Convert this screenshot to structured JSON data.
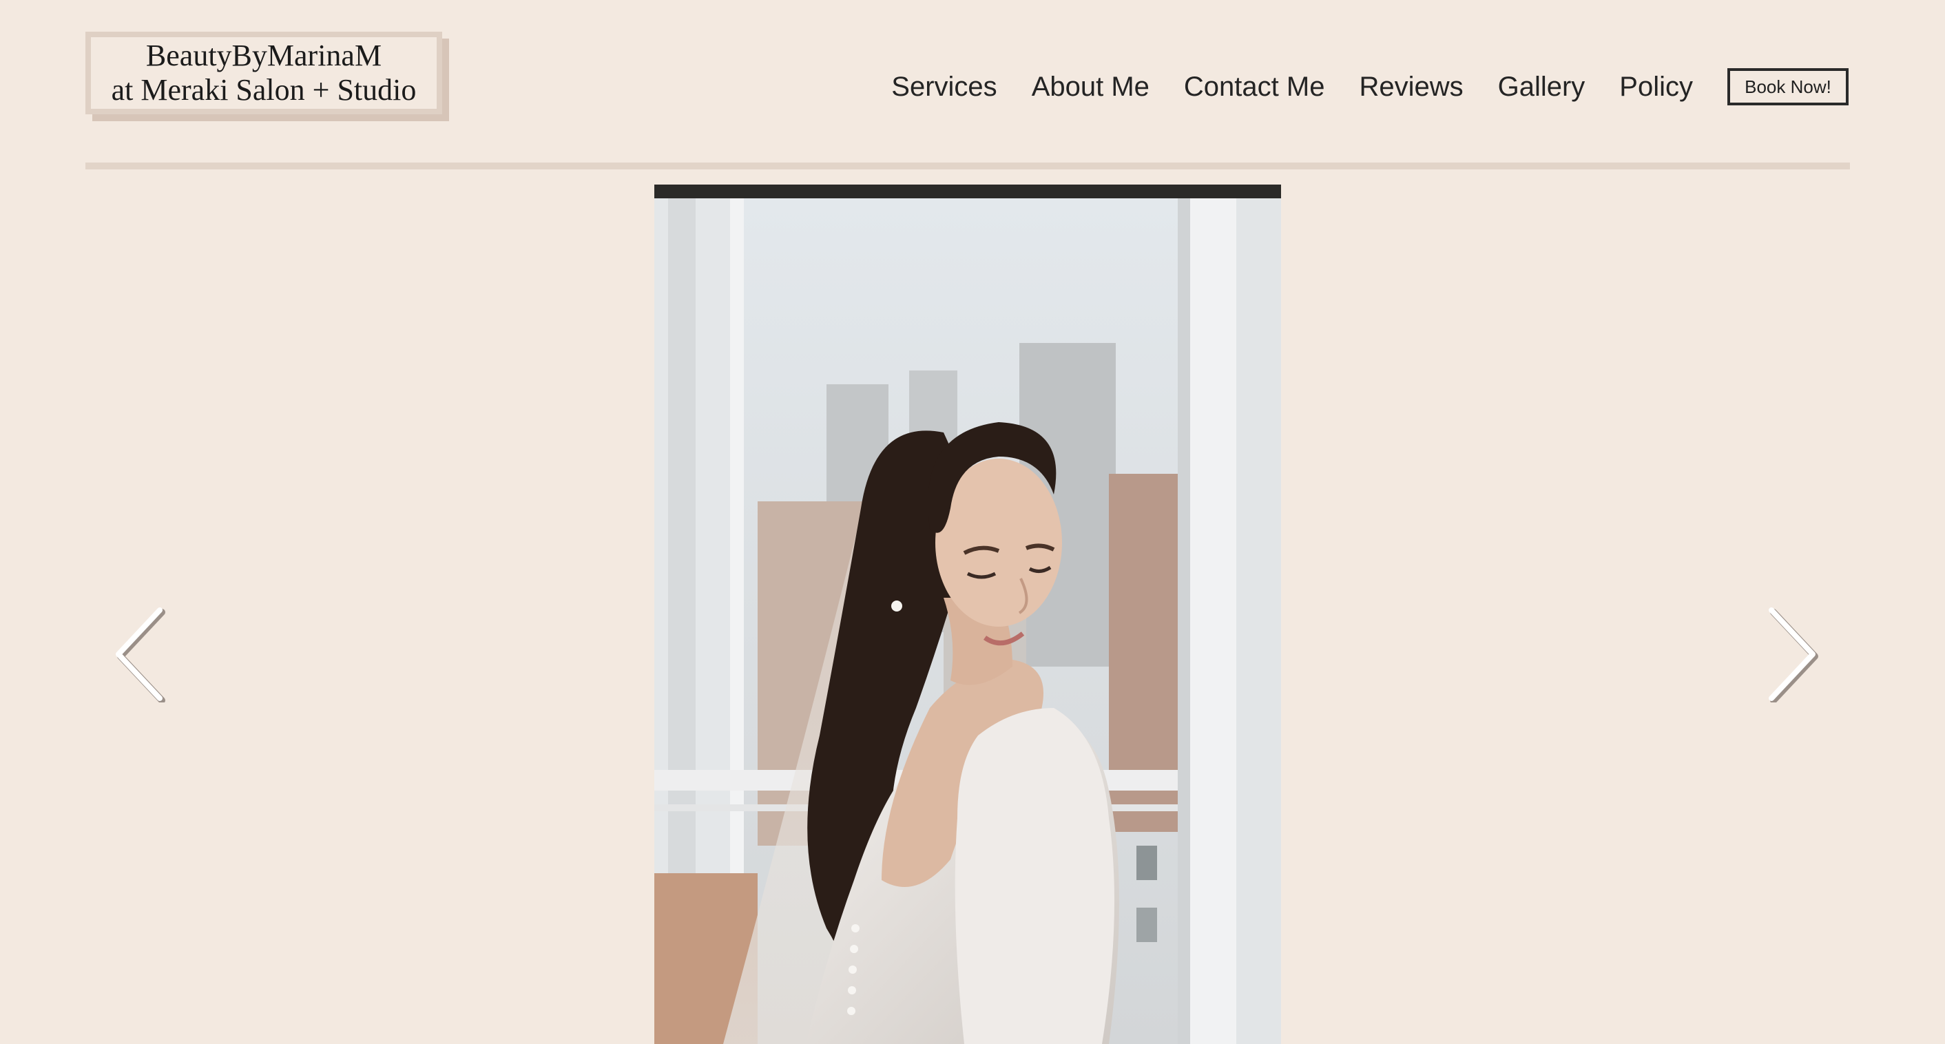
{
  "header": {
    "logo_line1": "BeautyByMarinaM",
    "logo_line2": "at Meraki Salon + Studio"
  },
  "nav": {
    "items": [
      {
        "label": "Services"
      },
      {
        "label": "About Me"
      },
      {
        "label": "Contact Me"
      },
      {
        "label": "Reviews"
      },
      {
        "label": "Gallery"
      },
      {
        "label": "Policy"
      }
    ],
    "book_label": "Book Now!"
  },
  "gallery": {
    "prev_icon": "chevron-left-icon",
    "next_icon": "chevron-right-icon"
  },
  "colors": {
    "background": "#f3e9e0",
    "divider": "#e2d4c8",
    "logo_shadow": "#d7c5b8"
  }
}
